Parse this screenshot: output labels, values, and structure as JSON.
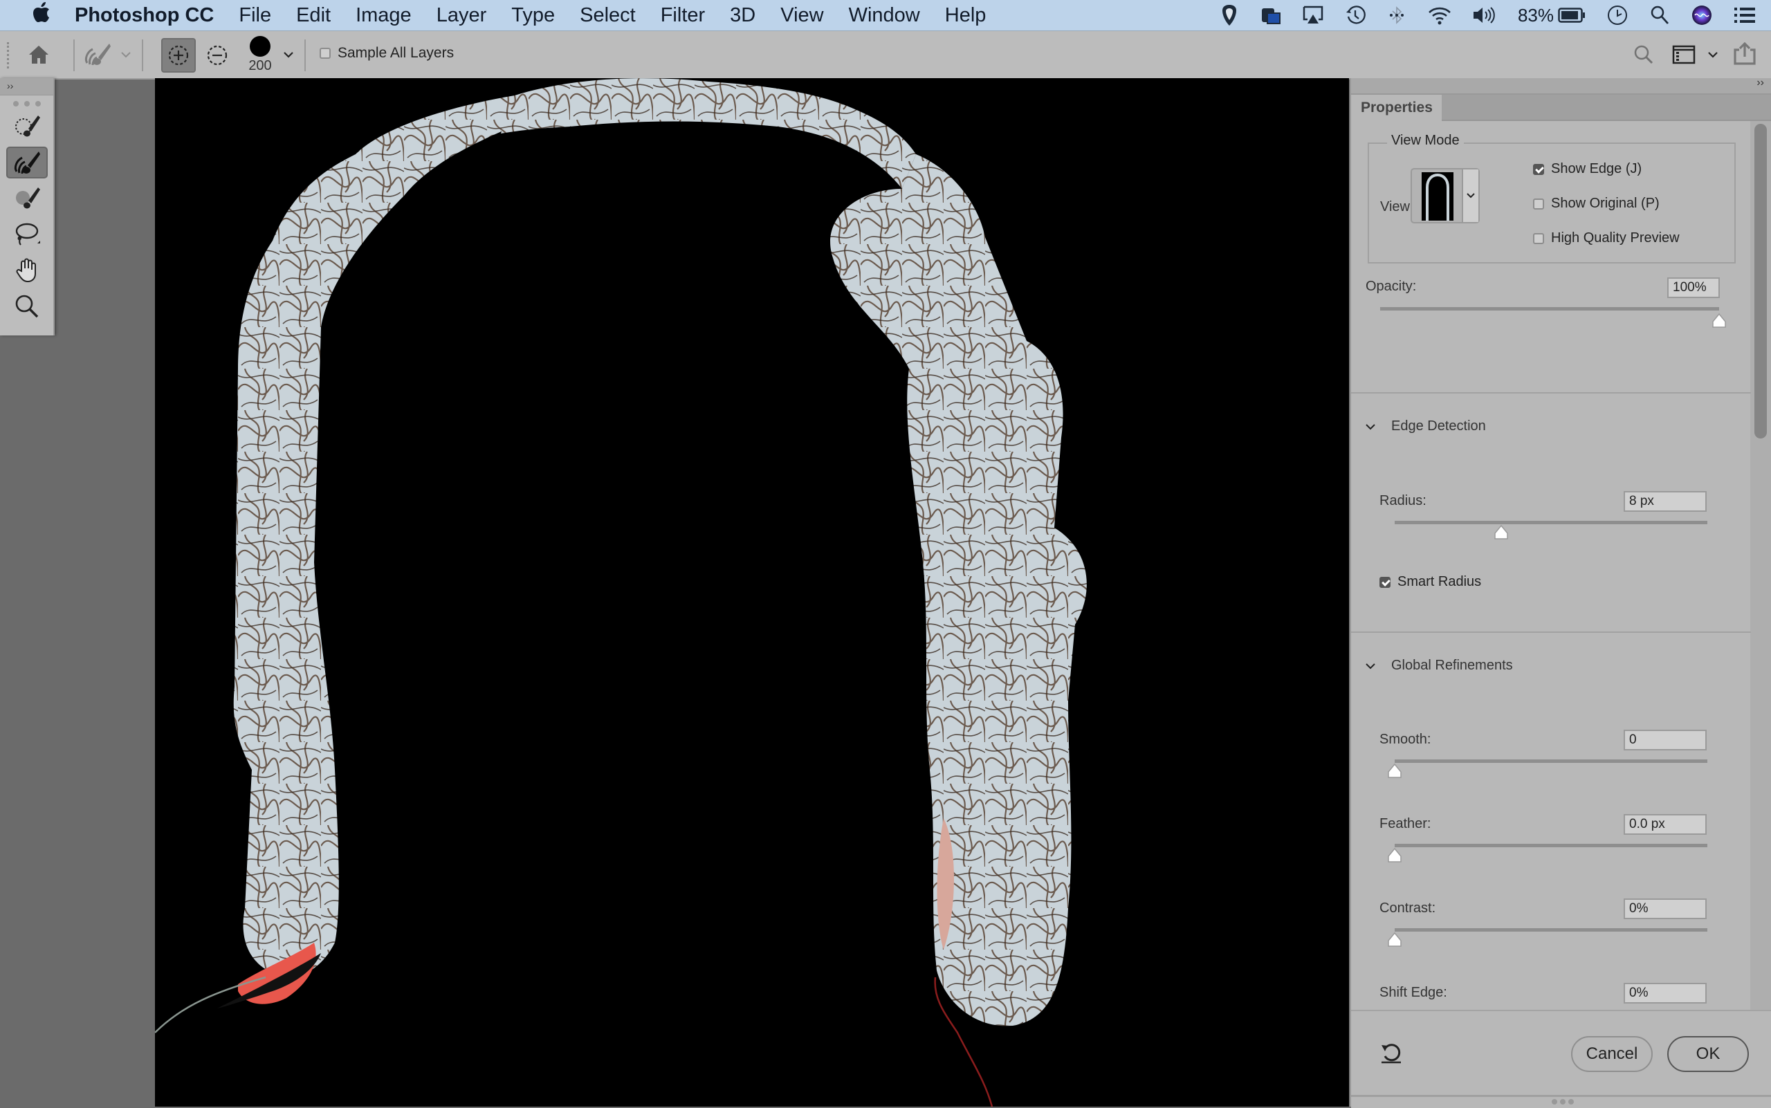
{
  "menubar": {
    "app_name": "Photoshop CC",
    "items": [
      "File",
      "Edit",
      "Image",
      "Layer",
      "Type",
      "Select",
      "Filter",
      "3D",
      "View",
      "Window",
      "Help"
    ],
    "status": {
      "battery_percent": "83%",
      "icons": [
        "shield-icon",
        "camera-app-icon",
        "airplay-icon",
        "time-machine-icon",
        "bluetooth-icon",
        "wifi-icon",
        "volume-icon",
        "battery-icon",
        "clock-icon",
        "spotlight-search-icon",
        "siri-icon",
        "notification-center-icon"
      ]
    }
  },
  "options_bar": {
    "brush_size": "200",
    "sample_all_layers_label": "Sample All Layers",
    "sample_all_layers_checked": false,
    "mode": "add"
  },
  "tools": [
    {
      "name": "quick-selection-tool",
      "selected": false
    },
    {
      "name": "refine-edge-brush-tool",
      "selected": true
    },
    {
      "name": "brush-tool",
      "selected": false
    },
    {
      "name": "lasso-tool",
      "selected": false
    },
    {
      "name": "hand-tool",
      "selected": false
    },
    {
      "name": "zoom-tool",
      "selected": false
    }
  ],
  "colors": {
    "menubar_bg": "#bdd3ea",
    "panel_bg": "#b8b8b8",
    "canvas_bg": "#000000",
    "edge_overlay": "#c8d2d8",
    "hair": "#4a3a2e",
    "shirt_red": "#e8574c"
  },
  "properties": {
    "tab_label": "Properties",
    "view_mode": {
      "legend": "View Mode",
      "view_label": "View:",
      "show_edge_label": "Show Edge (J)",
      "show_edge_checked": true,
      "show_original_label": "Show Original (P)",
      "show_original_checked": false,
      "hq_preview_label": "High Quality Preview",
      "hq_preview_checked": false
    },
    "opacity": {
      "label": "Opacity:",
      "value": "100%",
      "fraction": 1.0
    },
    "edge_detection": {
      "title": "Edge Detection",
      "radius_label": "Radius:",
      "radius_value": "8 px",
      "radius_fraction": 0.34,
      "smart_radius_label": "Smart Radius",
      "smart_radius_checked": true
    },
    "global_refinements": {
      "title": "Global Refinements",
      "smooth_label": "Smooth:",
      "smooth_value": "0",
      "smooth_fraction": 0,
      "feather_label": "Feather:",
      "feather_value": "0.0 px",
      "feather_fraction": 0,
      "contrast_label": "Contrast:",
      "contrast_value": "0%",
      "contrast_fraction": 0,
      "shift_edge_label": "Shift Edge:",
      "shift_edge_value": "0%"
    },
    "footer": {
      "cancel_label": "Cancel",
      "ok_label": "OK"
    }
  }
}
